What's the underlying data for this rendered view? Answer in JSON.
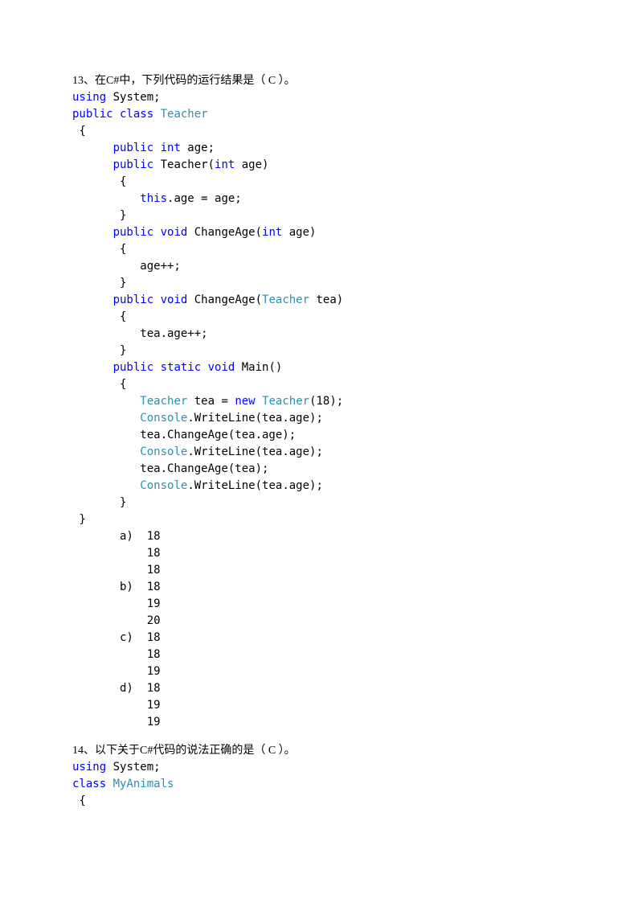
{
  "q13": {
    "intro": "13、在C#中，下列代码的运行结果是（ C ）。",
    "code": {
      "l01_kw1": "using",
      "l01_p": " System;",
      "l02_kw1": "public",
      "l02_kw2": " class",
      "l02_t": " Teacher",
      "l03": " {",
      "l04_kw1": "      public",
      "l04_kw2": " int",
      "l04_p": " age;",
      "l05_kw1": "      public",
      "l05_p1": " Teacher(",
      "l05_kw2": "int",
      "l05_p2": " age)",
      "l06": "       {",
      "l07_pre": "          ",
      "l07_kw": "this",
      "l07_p": ".age = age;",
      "l08": "       }",
      "l09_kw1": "      public",
      "l09_kw2": " void",
      "l09_p1": " ChangeAge(",
      "l09_kw3": "int",
      "l09_p2": " age)",
      "l10": "       {",
      "l11": "          age++;",
      "l12": "       }",
      "l13_kw1": "      public",
      "l13_kw2": " void",
      "l13_p1": " ChangeAge(",
      "l13_t": "Teacher",
      "l13_p2": " tea)",
      "l14": "       {",
      "l15": "          tea.age++;",
      "l16": "       }",
      "l17_kw1": "      public",
      "l17_kw2": " static",
      "l17_kw3": " void",
      "l17_p": " Main()",
      "l18": "       {",
      "l19_pre": "          ",
      "l19_t1": "Teacher",
      "l19_p1": " tea = ",
      "l19_kw": "new",
      "l19_p2": " ",
      "l19_t2": "Teacher",
      "l19_p3": "(18);",
      "l20_pre": "          ",
      "l20_t": "Console",
      "l20_p": ".WriteLine(tea.age);",
      "l21": "          tea.ChangeAge(tea.age);",
      "l22_pre": "          ",
      "l22_t": "Console",
      "l22_p": ".WriteLine(tea.age);",
      "l23": "          tea.ChangeAge(tea);",
      "l24_pre": "          ",
      "l24_t": "Console",
      "l24_p": ".WriteLine(tea.age);",
      "l25": "       }",
      "l26": " }"
    },
    "options": "       a)  18\n           18\n           18\n       b)  18\n           19\n           20\n       c)  18\n           18\n           19\n       d)  18\n           19\n           19"
  },
  "q14": {
    "intro": "14、以下关于C#代码的说法正确的是（ C ）。",
    "code": {
      "l01_kw1": "using",
      "l01_p": " System;",
      "l02_kw1": "class",
      "l02_t": " MyAnimals",
      "l03": " {"
    }
  }
}
